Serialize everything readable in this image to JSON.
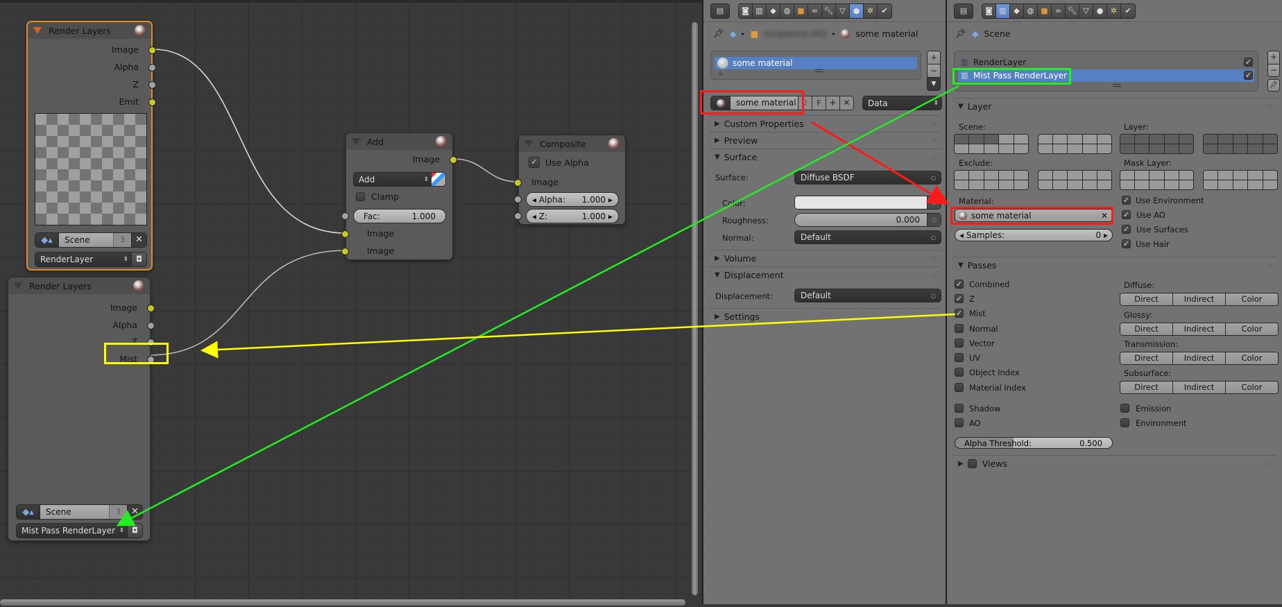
{
  "node_editor": {
    "nodes": {
      "render_layers_1": {
        "title": "Render Layers",
        "outputs": [
          "Image",
          "Alpha",
          "Z",
          "Emit"
        ],
        "scene_label": "Scene",
        "scene_users": "3",
        "layer_label": "RenderLayer"
      },
      "render_layers_2": {
        "title": "Render Layers",
        "outputs": [
          "Image",
          "Alpha",
          "Z",
          "Mist"
        ],
        "scene_label": "Scene",
        "scene_users": "3",
        "layer_label": "Mist Pass RenderLayer"
      },
      "add": {
        "title": "Add",
        "output": "Image",
        "blend_mode": "Add",
        "clamp_label": "Clamp",
        "clamp_checked": false,
        "fac_label": "Fac:",
        "fac_value": "1.000",
        "inputs": [
          "Image",
          "Image"
        ]
      },
      "composite": {
        "title": "Composite",
        "use_alpha_label": "Use Alpha",
        "use_alpha_checked": true,
        "input": "Image",
        "alpha_label": "Alpha:",
        "alpha_value": "1.000",
        "z_label": "Z:",
        "z_value": "1.000"
      }
    }
  },
  "material_panel": {
    "breadcrumb": {
      "object_name": "tungsteno.002",
      "material": "some material"
    },
    "slot_list": [
      "some material"
    ],
    "datablock": {
      "name": "some material",
      "users": "2",
      "fake_user": "F",
      "link": "Data"
    },
    "sections": {
      "custom_properties": "Custom Properties",
      "preview": "Preview",
      "surface": "Surface",
      "volume": "Volume",
      "displacement": "Displacement",
      "settings": "Settings"
    },
    "surface": {
      "surface_label": "Surface:",
      "surface_value": "Diffuse BSDF",
      "color_label": "Color:",
      "color_value": "#e6e6e6",
      "roughness_label": "Roughness:",
      "roughness_value": "0.000",
      "normal_label": "Normal:",
      "normal_value": "Default"
    },
    "displacement": {
      "label": "Displacement:",
      "value": "Default"
    }
  },
  "render_layers_panel": {
    "breadcrumb": "Scene",
    "layers": [
      {
        "name": "RenderLayer",
        "enabled": true,
        "selected": false
      },
      {
        "name": "Mist Pass RenderLayer",
        "enabled": true,
        "selected": true
      }
    ],
    "layer_section": {
      "title": "Layer",
      "scene_label": "Scene:",
      "layer_label": "Layer:",
      "exclude_label": "Exclude:",
      "mask_layer_label": "Mask Layer:",
      "material_label": "Material:",
      "material_value": "some material",
      "samples_label": "Samples:",
      "samples_value": "0",
      "toggles": [
        {
          "label": "Use Environment",
          "checked": true
        },
        {
          "label": "Use AO",
          "checked": true
        },
        {
          "label": "Use Surfaces",
          "checked": true
        },
        {
          "label": "Use Hair",
          "checked": true
        }
      ]
    },
    "passes_section": {
      "title": "Passes",
      "passes": [
        {
          "label": "Combined",
          "checked": true
        },
        {
          "label": "Z",
          "checked": true
        },
        {
          "label": "Mist",
          "checked": true
        },
        {
          "label": "Normal",
          "checked": false
        },
        {
          "label": "Vector",
          "checked": false
        },
        {
          "label": "UV",
          "checked": false
        },
        {
          "label": "Object Index",
          "checked": false
        },
        {
          "label": "Material Index",
          "checked": false
        }
      ],
      "extra_left": [
        {
          "label": "Shadow",
          "checked": false
        },
        {
          "label": "AO",
          "checked": false
        }
      ],
      "extra_right": [
        {
          "label": "Emission",
          "checked": false
        },
        {
          "label": "Environment",
          "checked": false
        }
      ],
      "groups": [
        {
          "label": "Diffuse:",
          "buttons": [
            "Direct",
            "Indirect",
            "Color"
          ]
        },
        {
          "label": "Glossy:",
          "buttons": [
            "Direct",
            "Indirect",
            "Color"
          ]
        },
        {
          "label": "Transmission:",
          "buttons": [
            "Direct",
            "Indirect",
            "Color"
          ]
        },
        {
          "label": "Subsurface:",
          "buttons": [
            "Direct",
            "Indirect",
            "Color"
          ]
        }
      ],
      "alpha_threshold_label": "Alpha Threshold:",
      "alpha_threshold_value": "0.500",
      "alpha_threshold_fraction": 0.5
    },
    "views_section": {
      "title": "Views",
      "checked": false
    }
  },
  "annotations": {
    "colors": {
      "red": "#ff1a1a",
      "green": "#22ee22",
      "yellow": "#ffff00"
    }
  }
}
